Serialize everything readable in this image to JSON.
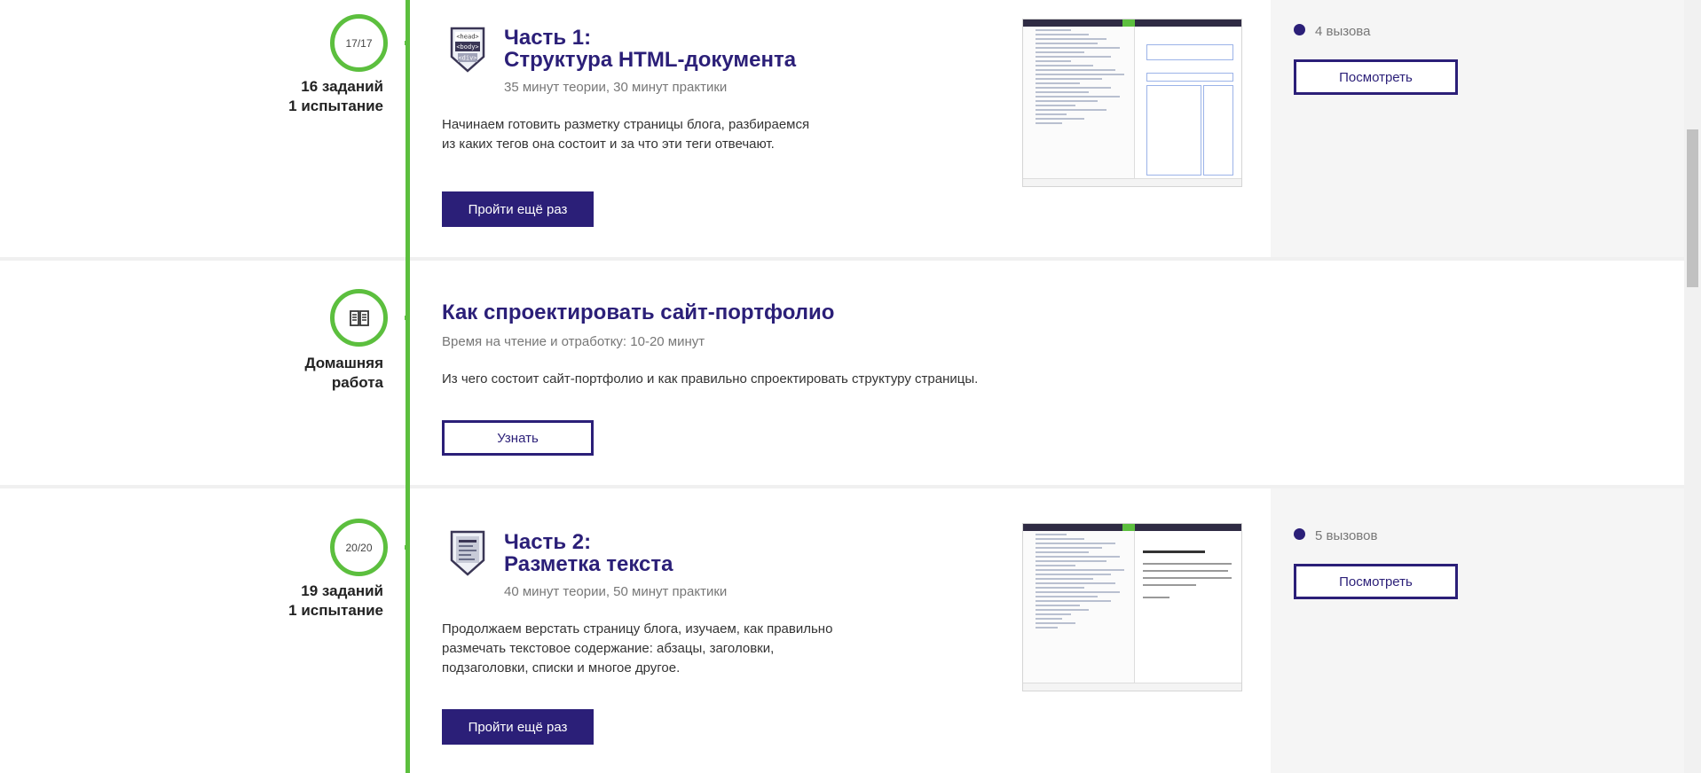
{
  "lessons": [
    {
      "progress": "17/17",
      "meta_line1": "16 заданий",
      "meta_line2": "1 испытание",
      "icon": "html-tags-badge-icon",
      "badge_tags": [
        "<head>",
        "<body>",
        "<div>"
      ],
      "title_line1": "Часть 1:",
      "title_line2": "Структура HTML-документа",
      "duration": "35 минут теории, 30 минут практики",
      "desc_line1": "Начинаем готовить разметку страницы блога, разбираемся",
      "desc_line2": "из каких тегов она состоит и за что эти теги отвечают.",
      "button_label": "Пройти ещё раз",
      "challenges": "4 вызова",
      "view_label": "Посмотреть"
    },
    {
      "icon": "book-icon",
      "meta_line1": "Домашняя",
      "meta_line2": "работа",
      "title": "Как спроектировать сайт-портфолио",
      "duration": "Время на чтение и отработку: 10-20 минут",
      "desc": "Из чего состоит сайт-портфолио и как правильно спроектировать структуру страницы.",
      "button_label": "Узнать"
    },
    {
      "progress": "20/20",
      "meta_line1": "19 заданий",
      "meta_line2": "1 испытание",
      "icon": "text-document-badge-icon",
      "title_line1": "Часть 2:",
      "title_line2": "Разметка текста",
      "duration": "40 минут теории, 50 минут практики",
      "desc_line1": "Продолжаем верстать страницу блога, изучаем, как правильно",
      "desc_line2": "размечать текстовое содержание: абзацы, заголовки,",
      "desc_line3": "подзаголовки, списки и многое другое.",
      "button_label": "Пройти ещё раз",
      "challenges": "5 вызовов",
      "view_label": "Посмотреть"
    }
  ],
  "colors": {
    "accent_green": "#5cbf3e",
    "brand_purple": "#2b1f78",
    "panel_gray": "#f5f5f5"
  }
}
